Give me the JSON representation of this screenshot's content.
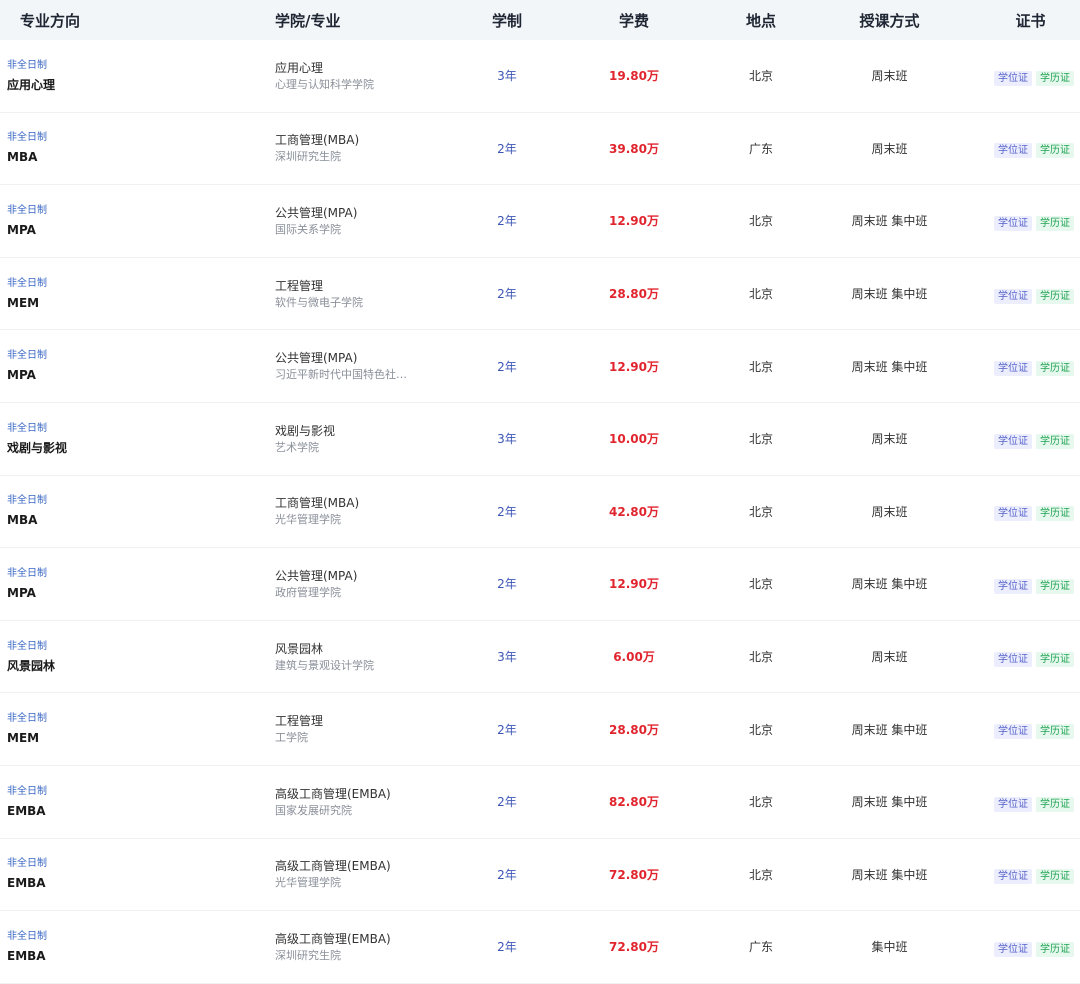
{
  "header": {
    "major": "专业方向",
    "school": "学院/专业",
    "years": "学制",
    "fee": "学费",
    "location": "地点",
    "mode": "授课方式",
    "cert": "证书"
  },
  "badges": {
    "degree": "学位证",
    "edu": "学历证"
  },
  "rows": [
    {
      "type": "非全日制",
      "major": "应用心理",
      "program": "应用心理",
      "school": "心理与认知科学学院",
      "years": "3年",
      "fee": "19.80万",
      "location": "北京",
      "mode": "周末班"
    },
    {
      "type": "非全日制",
      "major": "MBA",
      "program": "工商管理(MBA)",
      "school": "深圳研究生院",
      "years": "2年",
      "fee": "39.80万",
      "location": "广东",
      "mode": "周末班"
    },
    {
      "type": "非全日制",
      "major": "MPA",
      "program": "公共管理(MPA)",
      "school": "国际关系学院",
      "years": "2年",
      "fee": "12.90万",
      "location": "北京",
      "mode": "周末班 集中班"
    },
    {
      "type": "非全日制",
      "major": "MEM",
      "program": "工程管理",
      "school": "软件与微电子学院",
      "years": "2年",
      "fee": "28.80万",
      "location": "北京",
      "mode": "周末班 集中班"
    },
    {
      "type": "非全日制",
      "major": "MPA",
      "program": "公共管理(MPA)",
      "school": "习近平新时代中国特色社…",
      "years": "2年",
      "fee": "12.90万",
      "location": "北京",
      "mode": "周末班 集中班"
    },
    {
      "type": "非全日制",
      "major": "戏剧与影视",
      "program": "戏剧与影视",
      "school": "艺术学院",
      "years": "3年",
      "fee": "10.00万",
      "location": "北京",
      "mode": "周末班"
    },
    {
      "type": "非全日制",
      "major": "MBA",
      "program": "工商管理(MBA)",
      "school": "光华管理学院",
      "years": "2年",
      "fee": "42.80万",
      "location": "北京",
      "mode": "周末班"
    },
    {
      "type": "非全日制",
      "major": "MPA",
      "program": "公共管理(MPA)",
      "school": "政府管理学院",
      "years": "2年",
      "fee": "12.90万",
      "location": "北京",
      "mode": "周末班 集中班"
    },
    {
      "type": "非全日制",
      "major": "风景园林",
      "program": "风景园林",
      "school": "建筑与景观设计学院",
      "years": "3年",
      "fee": "6.00万",
      "location": "北京",
      "mode": "周末班"
    },
    {
      "type": "非全日制",
      "major": "MEM",
      "program": "工程管理",
      "school": "工学院",
      "years": "2年",
      "fee": "28.80万",
      "location": "北京",
      "mode": "周末班 集中班"
    },
    {
      "type": "非全日制",
      "major": "EMBA",
      "program": "高级工商管理(EMBA)",
      "school": "国家发展研究院",
      "years": "2年",
      "fee": "82.80万",
      "location": "北京",
      "mode": "周末班 集中班"
    },
    {
      "type": "非全日制",
      "major": "EMBA",
      "program": "高级工商管理(EMBA)",
      "school": "光华管理学院",
      "years": "2年",
      "fee": "72.80万",
      "location": "北京",
      "mode": "周末班 集中班"
    },
    {
      "type": "非全日制",
      "major": "EMBA",
      "program": "高级工商管理(EMBA)",
      "school": "深圳研究生院",
      "years": "2年",
      "fee": "72.80万",
      "location": "广东",
      "mode": "集中班"
    }
  ]
}
